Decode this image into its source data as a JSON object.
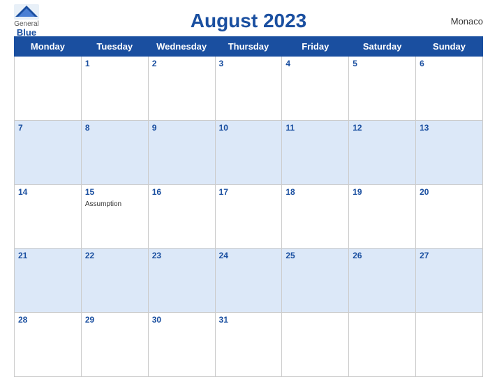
{
  "header": {
    "title": "August 2023",
    "country": "Monaco",
    "logo": {
      "general": "General",
      "blue": "Blue"
    }
  },
  "weekdays": [
    "Monday",
    "Tuesday",
    "Wednesday",
    "Thursday",
    "Friday",
    "Saturday",
    "Sunday"
  ],
  "weeks": [
    [
      {
        "num": "",
        "empty": true
      },
      {
        "num": "1"
      },
      {
        "num": "2"
      },
      {
        "num": "3"
      },
      {
        "num": "4"
      },
      {
        "num": "5"
      },
      {
        "num": "6"
      }
    ],
    [
      {
        "num": "7"
      },
      {
        "num": "8"
      },
      {
        "num": "9"
      },
      {
        "num": "10"
      },
      {
        "num": "11"
      },
      {
        "num": "12"
      },
      {
        "num": "13"
      }
    ],
    [
      {
        "num": "14"
      },
      {
        "num": "15",
        "holiday": "Assumption"
      },
      {
        "num": "16"
      },
      {
        "num": "17"
      },
      {
        "num": "18"
      },
      {
        "num": "19"
      },
      {
        "num": "20"
      }
    ],
    [
      {
        "num": "21"
      },
      {
        "num": "22"
      },
      {
        "num": "23"
      },
      {
        "num": "24"
      },
      {
        "num": "25"
      },
      {
        "num": "26"
      },
      {
        "num": "27"
      }
    ],
    [
      {
        "num": "28"
      },
      {
        "num": "29"
      },
      {
        "num": "30"
      },
      {
        "num": "31"
      },
      {
        "num": "",
        "empty": true
      },
      {
        "num": "",
        "empty": true
      },
      {
        "num": "",
        "empty": true
      }
    ]
  ],
  "row_styles": [
    "white-row",
    "blue-row",
    "white-row",
    "blue-row",
    "white-row"
  ]
}
